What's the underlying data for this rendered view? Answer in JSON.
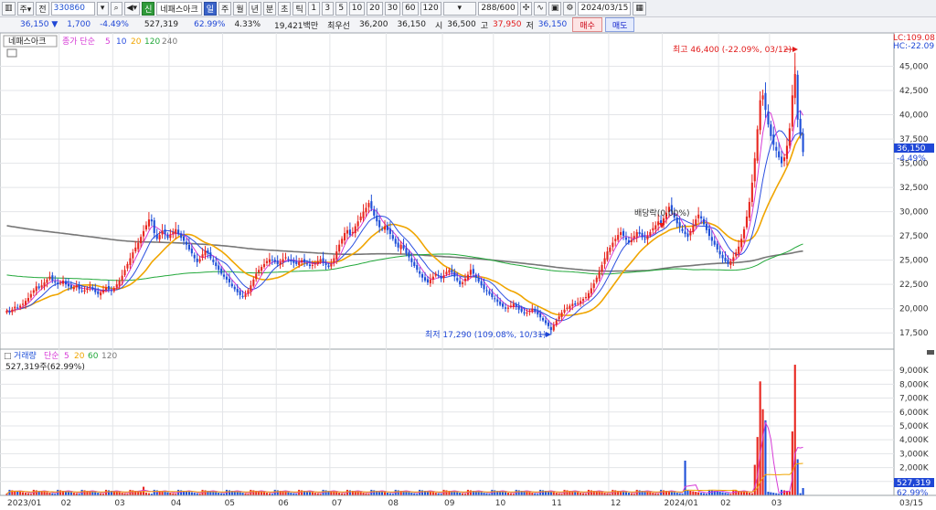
{
  "toolbar": {
    "code": "330860",
    "name": "네패스아크",
    "periods": [
      "일",
      "주",
      "월",
      "년",
      "분",
      "초",
      "틱"
    ],
    "active_period": "일",
    "intervals": [
      "1",
      "3",
      "5",
      "10",
      "20",
      "30",
      "60",
      "120"
    ],
    "count": "288",
    "count_total": "/600",
    "date": "2024/03/15",
    "badge_new": "신",
    "all_label": "전"
  },
  "quote": {
    "price": "36,150",
    "arrow": "▼",
    "change": "1,700",
    "change_pct": "-4.49%",
    "volume": "527,319",
    "volume_ratio": "62.99%",
    "turnover": "4.33%",
    "amount": "19,421백만",
    "best_label": "최우선",
    "best_ask": "36,200",
    "best_bid": "36,150",
    "open_label": "시",
    "open": "36,500",
    "high_label": "고",
    "high": "37,950",
    "low_label": "저",
    "low": "36,150",
    "buy_label": "매수",
    "sell_label": "매도"
  },
  "price_legend": {
    "name": "네패스아크",
    "type": "종가 단순",
    "mas": [
      "5",
      "10",
      "20",
      "120",
      "240"
    ],
    "ma_colors": [
      "#d63ad6",
      "#2b4fe0",
      "#f0a500",
      "#22a83a",
      "#777777"
    ]
  },
  "volume_legend": {
    "name": "거래량",
    "type": "단순",
    "mas": [
      "5",
      "20",
      "60",
      "120"
    ],
    "ma_colors": [
      "#d63ad6",
      "#f0a500",
      "#22a83a",
      "#777777"
    ],
    "value_label": "527,319주(62.99%)"
  },
  "annotations": {
    "high": "최고 46,400 (-22.09%, 03/12)",
    "low": "최저 17,290 (109.08%, 10/31)",
    "dividend": "배당락(0.00%)",
    "lc": "LC:109.08",
    "hc": "HC:-22.09",
    "price_box": "36,150",
    "price_box_pct": "-4.49%",
    "vol_box": "527,319",
    "vol_box_pct": "62.99%"
  },
  "price_axis": [
    "45,000",
    "42,500",
    "40,000",
    "37,500",
    "35,000",
    "32,500",
    "30,000",
    "27,500",
    "25,000",
    "22,500",
    "20,000",
    "17,500"
  ],
  "volume_axis": [
    "9,000K",
    "8,000K",
    "7,000K",
    "6,000K",
    "5,000K",
    "4,000K",
    "3,000K",
    "2,000K",
    "1,000K"
  ],
  "date_axis": [
    "2023/01",
    "02",
    "03",
    "04",
    "05",
    "06",
    "07",
    "08",
    "09",
    "10",
    "11",
    "12",
    "2024/01",
    "02",
    "03",
    "03/15"
  ],
  "chart_data": {
    "type": "candlestick",
    "price_range": [
      16200,
      47500
    ],
    "volume_range": [
      0,
      9600
    ],
    "colors": {
      "up": "#e8261f",
      "down": "#1e4fd8"
    },
    "months": [
      {
        "label": "2023/01",
        "closes": [
          19800,
          19600,
          19900,
          20200,
          20100,
          20300,
          20500,
          20800,
          21100,
          21500,
          21900,
          22300,
          22100,
          22400,
          22700,
          23000,
          23300,
          22900,
          22700,
          22500
        ]
      },
      {
        "label": "02",
        "closes": [
          22700,
          22900,
          22500,
          22300,
          22100,
          22200,
          22400,
          22000,
          21800,
          21900,
          22100,
          22300,
          22000,
          21700,
          21500,
          21700,
          21900,
          22200,
          22000,
          21800
        ]
      },
      {
        "label": "03",
        "closes": [
          22100,
          22500,
          22900,
          23400,
          24000,
          24600,
          25200,
          25800,
          26300,
          26800,
          27400,
          28000,
          28600,
          29200,
          29000,
          27800,
          27200,
          27600,
          28000,
          27700,
          27300
        ]
      },
      {
        "label": "04",
        "closes": [
          27600,
          27900,
          28200,
          27700,
          27300,
          27000,
          26600,
          26100,
          25700,
          25200,
          24800,
          25100,
          25600,
          26000,
          25700,
          25200,
          24800,
          24400,
          24000,
          23600
        ]
      },
      {
        "label": "05",
        "closes": [
          23300,
          23000,
          22700,
          22300,
          22000,
          21700,
          21400,
          21200,
          21500,
          21900,
          22400,
          23000,
          23600,
          24000,
          24300,
          24600,
          24900,
          25100,
          25000,
          24800
        ]
      },
      {
        "label": "06",
        "closes": [
          24600,
          24800,
          25100,
          25300,
          25100,
          24900,
          24700,
          24600,
          24800,
          25000,
          24800,
          24600,
          24400,
          24500,
          24700,
          24900,
          25100,
          24800,
          24500,
          24300
        ]
      },
      {
        "label": "07",
        "closes": [
          24600,
          25200,
          25900,
          26600,
          27200,
          27800,
          28100,
          27600,
          27900,
          28500,
          29000,
          29500,
          30000,
          30400,
          30900,
          30300,
          29600,
          29000,
          28400,
          28200,
          28500
        ]
      },
      {
        "label": "08",
        "closes": [
          28100,
          27700,
          27200,
          26700,
          26300,
          26600,
          26200,
          25700,
          25300,
          24800,
          24400,
          24000,
          23600,
          23200,
          22900,
          22700,
          23000,
          23300,
          23600,
          23400,
          23100
        ]
      },
      {
        "label": "09",
        "closes": [
          23400,
          23800,
          24000,
          23700,
          23300,
          22900,
          22500,
          22700,
          23100,
          23500,
          24000,
          23600,
          23200,
          22800,
          22400,
          22000,
          21800,
          21500,
          21200
        ]
      },
      {
        "label": "10",
        "closes": [
          21000,
          20700,
          20400,
          20200,
          20000,
          20100,
          20300,
          20500,
          20200,
          19900,
          19700,
          19500,
          19600,
          19800,
          20000,
          19700,
          19400,
          19100,
          18800,
          18500,
          18200
        ]
      },
      {
        "label": "11",
        "closes": [
          17800,
          18300,
          18800,
          19200,
          19600,
          19900,
          20100,
          20300,
          20500,
          20400,
          20600,
          20800,
          21000,
          21200,
          21600,
          22100,
          22600,
          23200,
          23800,
          24500,
          25200,
          25900
        ]
      },
      {
        "label": "12",
        "closes": [
          26300,
          26800,
          27200,
          27600,
          27900,
          27500,
          27100,
          26800,
          27100,
          27500,
          27900,
          27700,
          27400,
          27200,
          27500,
          27900,
          28300,
          28600,
          29000,
          28800
        ]
      },
      {
        "label": "2024/01",
        "closes": [
          29300,
          29900,
          30500,
          30000,
          29400,
          28800,
          28400,
          28000,
          27700,
          27400,
          28000,
          28600,
          29200,
          29700,
          29300,
          28700,
          28100,
          27500,
          27000,
          26600,
          26100
        ]
      },
      {
        "label": "02",
        "closes": [
          25600,
          25200,
          24900,
          24600,
          24900,
          25300,
          25800,
          26400,
          27200,
          28200,
          29500,
          31000,
          33000,
          35500,
          38500,
          41500,
          42000,
          40500,
          39000
        ]
      },
      {
        "label": "03",
        "closes": [
          37800,
          36900,
          36300,
          35600,
          35000,
          35600,
          36800,
          38600,
          42000,
          44200,
          39500,
          37850,
          36150
        ]
      }
    ],
    "highlight_volumes": [
      {
        "month": 2,
        "idx": 11,
        "vol": 620
      },
      {
        "month": 12,
        "idx": 8,
        "vol": 2500
      },
      {
        "month": 13,
        "idx": 13,
        "vol": 2200
      },
      {
        "month": 13,
        "idx": 14,
        "vol": 4200
      },
      {
        "month": 13,
        "idx": 15,
        "vol": 8200
      },
      {
        "month": 13,
        "idx": 16,
        "vol": 6200
      },
      {
        "month": 13,
        "idx": 17,
        "vol": 5400
      },
      {
        "month": 14,
        "idx": 8,
        "vol": 4600
      },
      {
        "month": 14,
        "idx": 9,
        "vol": 9400
      },
      {
        "month": 14,
        "idx": 10,
        "vol": 2600
      },
      {
        "month": 14,
        "idx": 12,
        "vol": 527
      }
    ],
    "high_point": {
      "date": "03/12",
      "price": 46400
    },
    "low_point": {
      "date": "10/31",
      "price": 17290
    }
  }
}
